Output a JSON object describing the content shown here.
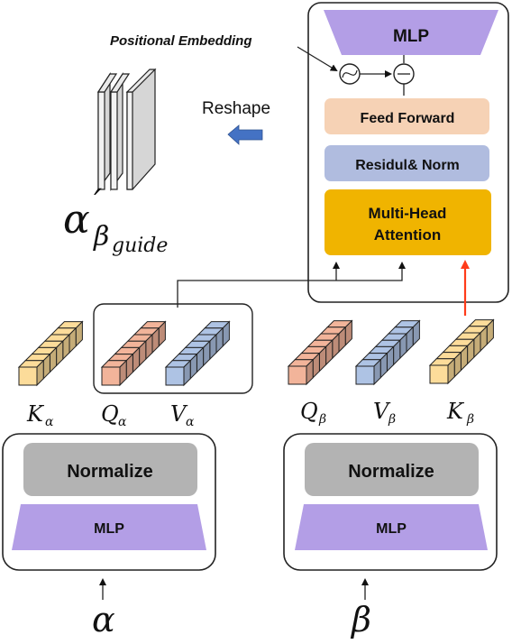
{
  "transformer_block": {
    "mlp_label": "MLP",
    "feed_forward_label": "Feed Forward",
    "residual_norm_label": "Residul& Norm",
    "attention_label_line1": "Multi-Head",
    "attention_label_line2": "Attention"
  },
  "positional_embedding_label": "Positional Embedding",
  "reshape_label": "Reshape",
  "output": {
    "symbol": "α",
    "prime": "′",
    "subscript_symbol": "β",
    "subscript_text": "guide"
  },
  "alpha_branch": {
    "normalize_label": "Normalize",
    "mlp_label": "MLP",
    "input_symbol": "α",
    "vectors": [
      {
        "letter": "K",
        "sub": "α"
      },
      {
        "letter": "Q",
        "sub": "α"
      },
      {
        "letter": "V",
        "sub": "α"
      }
    ]
  },
  "beta_branch": {
    "normalize_label": "Normalize",
    "mlp_label": "MLP",
    "input_symbol": "β",
    "vectors": [
      {
        "letter": "Q",
        "sub": "β"
      },
      {
        "letter": "V",
        "sub": "β"
      },
      {
        "letter": "K",
        "sub": "β"
      }
    ]
  },
  "colors": {
    "mlp": "#b39ee6",
    "feed_forward": "#f6d2b5",
    "residual_norm": "#b0bcdf",
    "attention": "#f0b400",
    "normalize": "#b3b3b3",
    "key_vector": "#fcdc9a",
    "query_vector": "#f2b49a",
    "value_vector": "#aec3e4",
    "red_arrow": "#ff3b1a",
    "reshape_arrow": "#4472c4"
  }
}
